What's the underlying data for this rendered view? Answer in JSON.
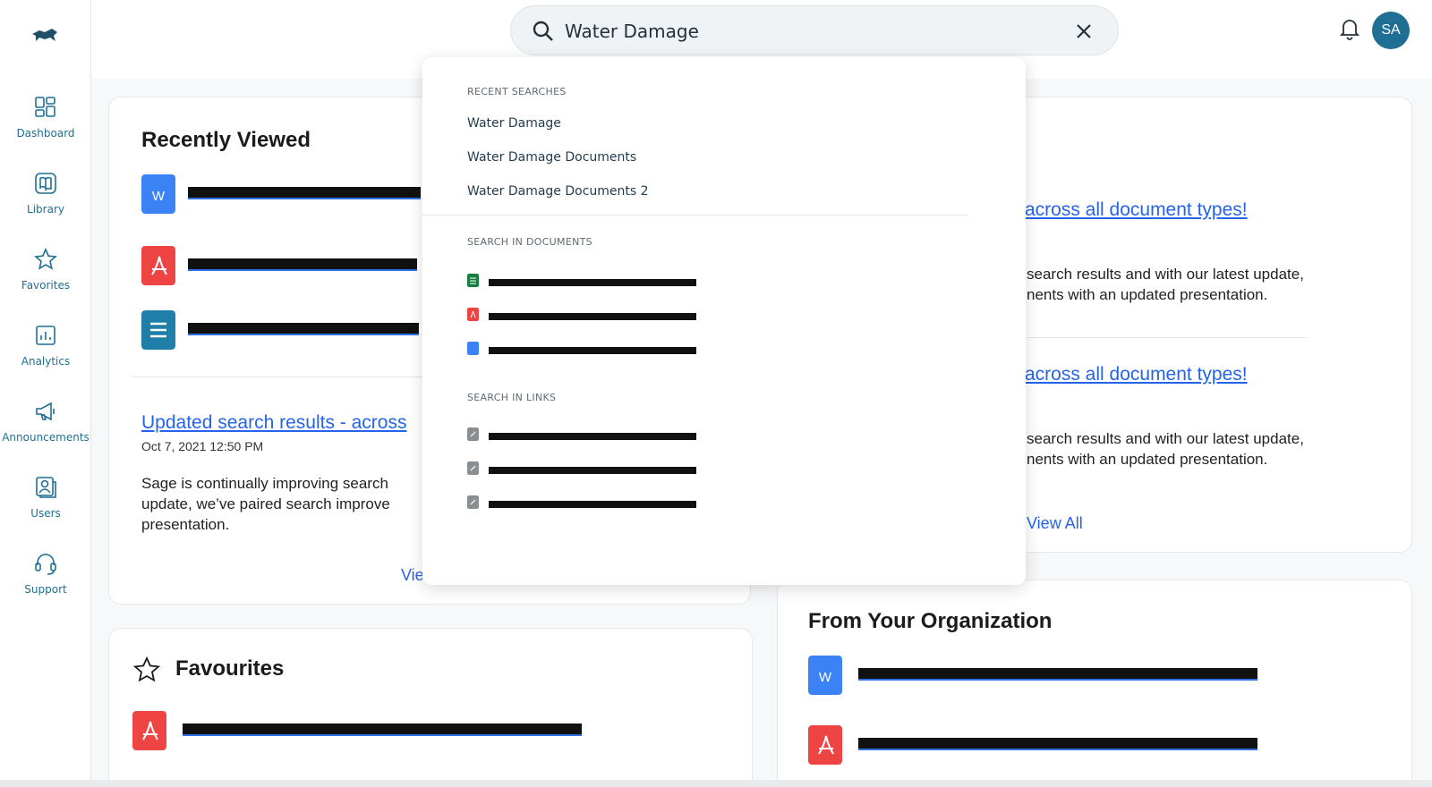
{
  "sidebar": {
    "items": [
      {
        "label": "Dashboard",
        "icon": "dashboard-icon"
      },
      {
        "label": "Library",
        "icon": "library-icon"
      },
      {
        "label": "Favorites",
        "icon": "star-icon"
      },
      {
        "label": "Analytics",
        "icon": "analytics-icon"
      },
      {
        "label": "Announcements",
        "icon": "megaphone-icon"
      },
      {
        "label": "Users",
        "icon": "users-icon"
      },
      {
        "label": "Support",
        "icon": "headset-icon"
      }
    ]
  },
  "header": {
    "search_value": "Water Damage",
    "avatar_initials": "SA"
  },
  "recently_viewed": {
    "title": "Recently Viewed",
    "announcement_title": "Updated search results - across",
    "announcement_date": "Oct 7, 2021 12:50 PM",
    "announcement_body_1": "Sage is continually improving search",
    "announcement_body_2": "update, we’ve paired search improve",
    "announcement_body_3": "presentation.",
    "view_all": "Vie"
  },
  "announcements": {
    "item1_title": "across all document types!",
    "item1_body_1": "search results and with our latest update,",
    "item1_body_2": "nents with an updated presentation.",
    "item2_title": "across all document types!",
    "item2_body_1": "search results and with our latest update,",
    "item2_body_2": "nents with an updated presentation.",
    "view_all": "View All"
  },
  "favourites": {
    "title": "Favourites"
  },
  "organization": {
    "title": "From Your Organization"
  },
  "dropdown": {
    "recent_heading": "RECENT SEARCHES",
    "recent": [
      "Water Damage",
      "Water Damage Documents",
      "Water Damage Documents 2"
    ],
    "documents_heading": "SEARCH IN DOCUMENTS",
    "links_heading": "SEARCH IN LINKS"
  },
  "colors": {
    "brand": "#1f6f94",
    "link": "#2563eb",
    "word": "#3b82f6",
    "pdf": "#ef4444",
    "sheet": "#15803d",
    "doc": "#1f7fa8"
  }
}
